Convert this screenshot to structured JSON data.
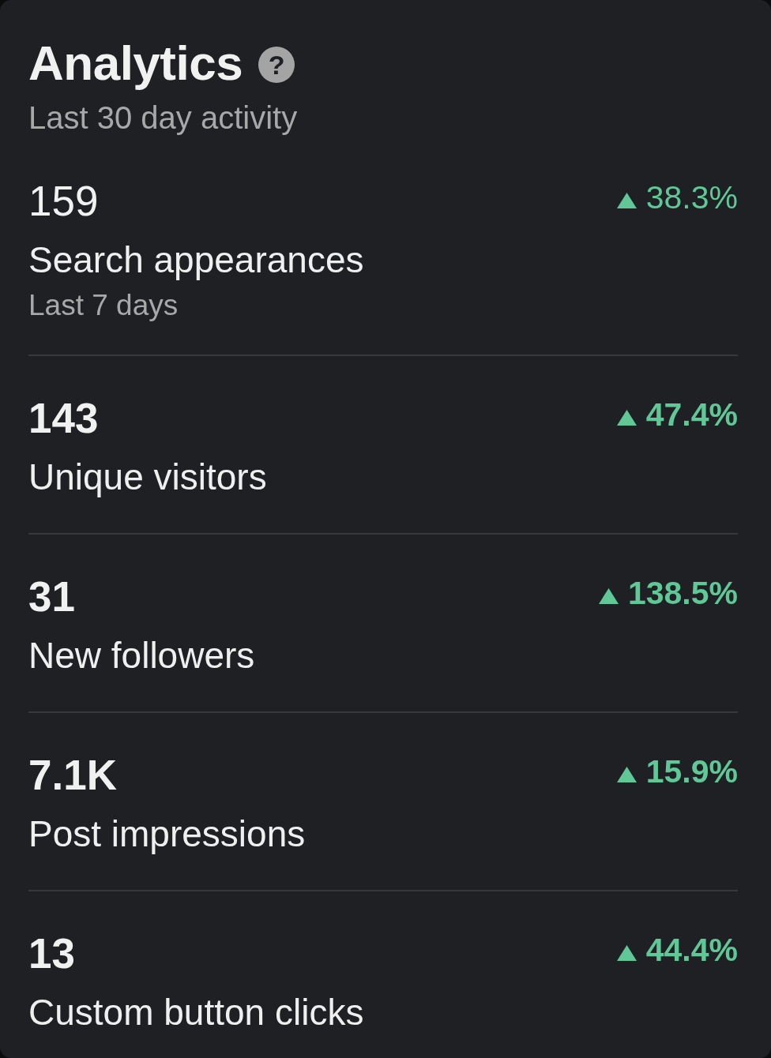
{
  "header": {
    "title": "Analytics",
    "help": "?",
    "subtitle": "Last 30 day activity"
  },
  "metrics": [
    {
      "value": "159",
      "label": "Search appearances",
      "note": "Last 7 days",
      "change": "38.3%",
      "up": true,
      "bold": false
    },
    {
      "value": "143",
      "label": "Unique visitors",
      "change": "47.4%",
      "up": true,
      "bold": true
    },
    {
      "value": "31",
      "label": "New followers",
      "change": "138.5%",
      "up": true,
      "bold": true
    },
    {
      "value": "7.1K",
      "label": "Post impressions",
      "change": "15.9%",
      "up": true,
      "bold": true
    },
    {
      "value": "13",
      "label": "Custom button clicks",
      "change": "44.4%",
      "up": true,
      "bold": true
    }
  ]
}
